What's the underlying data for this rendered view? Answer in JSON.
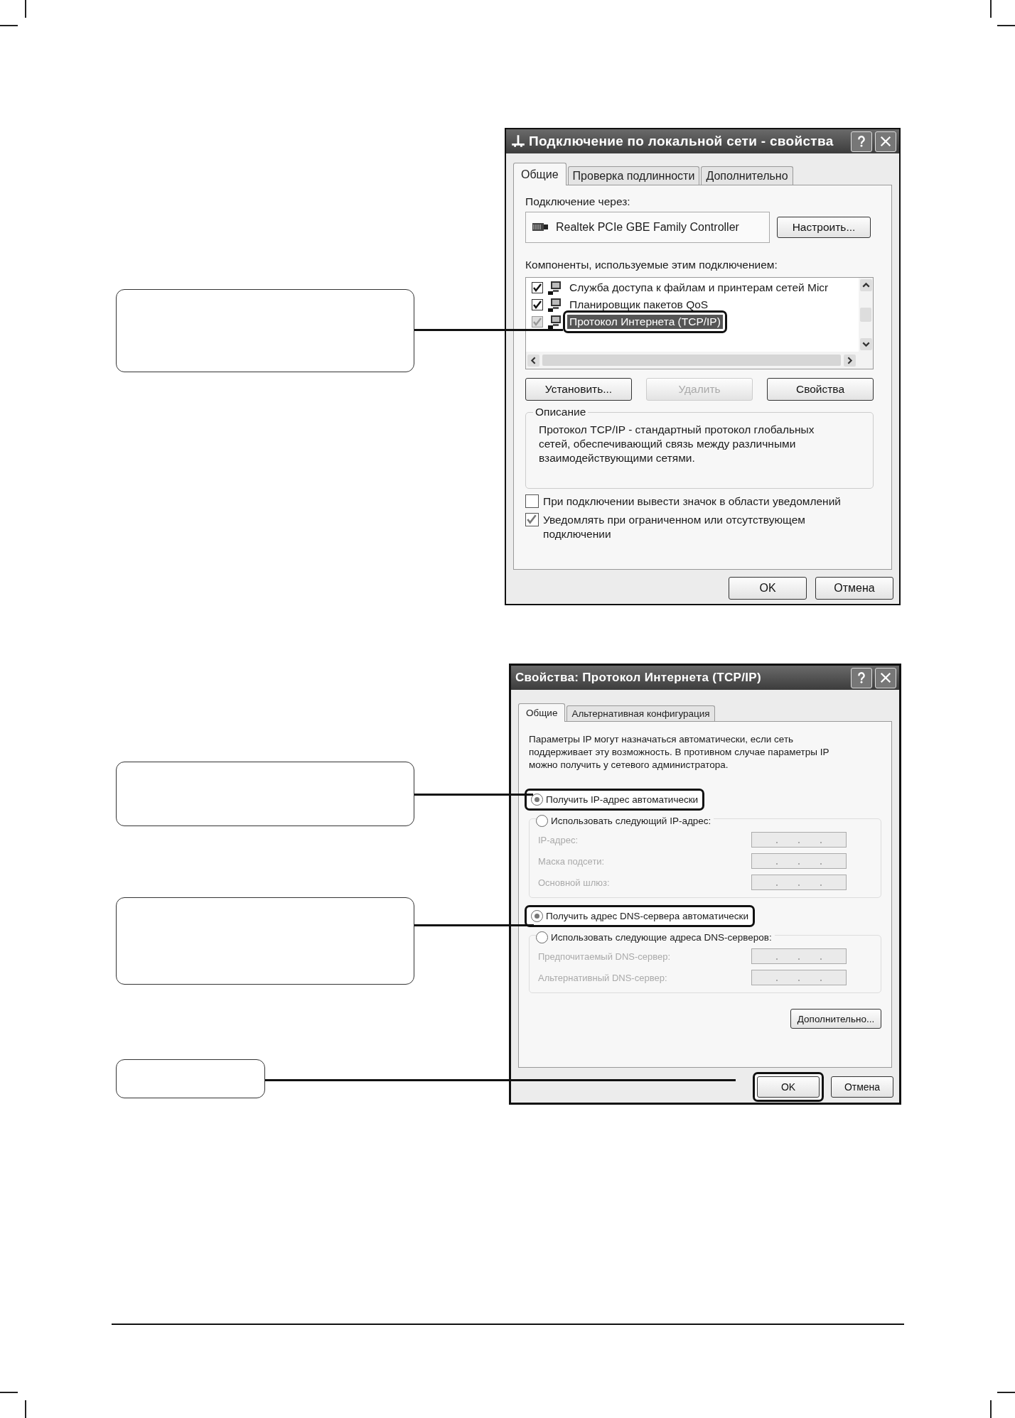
{
  "dialog_1": {
    "title": "Подключение по локальной сети - свойства",
    "tabs": [
      {
        "label": "Общие",
        "selected": true
      },
      {
        "label": "Проверка подлинности",
        "selected": false
      },
      {
        "label": "Дополнительно",
        "selected": false
      }
    ],
    "connect_via_label": "Подключение через:",
    "adapter": "Realtek PCIe GBE Family Controller",
    "configure_button": "Настроить...",
    "components_label": "Компоненты, используемые этим подключением:",
    "components": [
      {
        "label": "Служба доступа к файлам и принтерам сетей Micr",
        "checked": true,
        "disabled": false,
        "selected": false,
        "callout": false
      },
      {
        "label": "Планировщик пакетов QoS",
        "checked": true,
        "disabled": false,
        "selected": false,
        "callout": false
      },
      {
        "label": "Протокол Интернета (TCP/IP)",
        "checked": true,
        "disabled": true,
        "selected": true,
        "callout": true
      }
    ],
    "action_buttons": [
      {
        "label": "Установить...",
        "disabled": false
      },
      {
        "label": "Удалить",
        "disabled": true
      },
      {
        "label": "Свойства",
        "disabled": false
      }
    ],
    "description": {
      "title": "Описание",
      "text": "Протокол TCP/IP - стандартный протокол глобальных сетей, обеспечивающий связь между различными взаимодействующими сетями."
    },
    "options": [
      {
        "label": "При подключении вывести значок в области уведомлений",
        "checked": false
      },
      {
        "label": "Уведомлять при ограниченном или отсутствующем подключении",
        "checked": true
      }
    ],
    "buttons": [
      {
        "label": "OK",
        "callout": false
      },
      {
        "label": "Отмена",
        "callout": false
      }
    ]
  },
  "dialog_2": {
    "title": "Свойства: Протокол Интернета (TCP/IP)",
    "tabs": [
      {
        "label": "Общие",
        "selected": true
      },
      {
        "label": "Альтернативная конфигурация",
        "selected": false
      }
    ],
    "intro": "Параметры IP могут назначаться автоматически, если сеть поддерживает эту возможность. В противном случае параметры IP можно получить у сетевого администратора.",
    "groups": [
      {
        "options": [
          {
            "label": "Получить IP-адрес автоматически",
            "selected": true,
            "callout": true
          },
          {
            "label": "Использовать следующий IP-адрес:",
            "selected": false,
            "callout": false
          }
        ],
        "fields": [
          {
            "label": "IP-адрес:",
            "disabled": true
          },
          {
            "label": "Маска подсети:",
            "disabled": true
          },
          {
            "label": "Основной шлюз:",
            "disabled": true
          }
        ]
      },
      {
        "options": [
          {
            "label": "Получить адрес DNS-сервера автоматически",
            "selected": true,
            "callout": true
          },
          {
            "label": "Использовать следующие адреса DNS-серверов:",
            "selected": false,
            "callout": false
          }
        ],
        "fields": [
          {
            "label": "Предпочитаемый DNS-сервер:",
            "disabled": true
          },
          {
            "label": "Альтернативный DNS-сервер:",
            "disabled": true
          }
        ]
      }
    ],
    "advanced_button": "Дополнительно...",
    "buttons": [
      {
        "label": "OK",
        "callout": true
      },
      {
        "label": "Отмена",
        "callout": false
      }
    ]
  }
}
